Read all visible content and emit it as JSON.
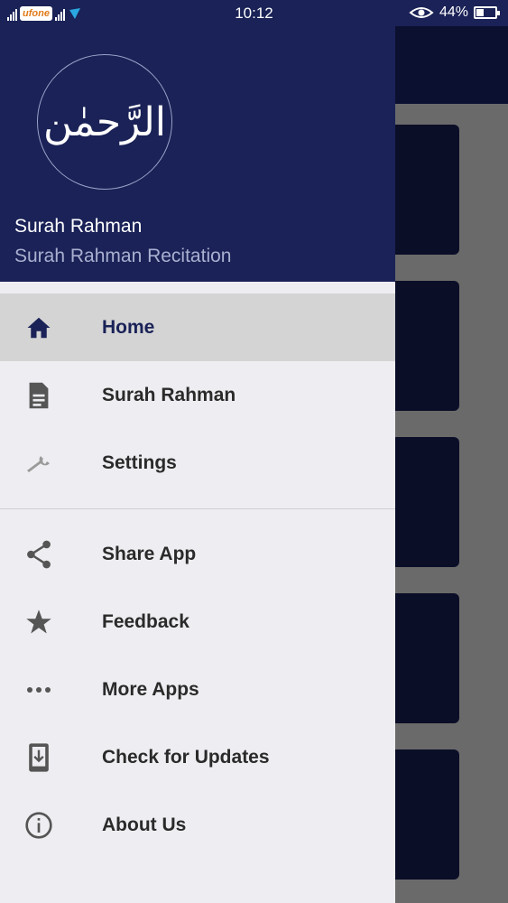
{
  "status_bar": {
    "carrier": "ufone",
    "time": "10:12",
    "battery": "44%"
  },
  "drawer": {
    "header": {
      "logo_text": "الرَّحمٰن",
      "title": "Surah Rahman",
      "subtitle": "Surah Rahman Recitation"
    },
    "primary_items": [
      {
        "label": "Home",
        "icon": "home-icon",
        "active": true
      },
      {
        "label": "Surah Rahman",
        "icon": "document-icon"
      },
      {
        "label": "Settings",
        "icon": "wrench-icon"
      }
    ],
    "secondary_items": [
      {
        "label": "Share App",
        "icon": "share-icon"
      },
      {
        "label": "Feedback",
        "icon": "star-icon"
      },
      {
        "label": "More Apps",
        "icon": "more-dots-icon"
      },
      {
        "label": "Check for Updates",
        "icon": "download-icon"
      },
      {
        "label": "About Us",
        "icon": "info-icon"
      }
    ]
  },
  "colors": {
    "header_bg": "#1a2257",
    "drawer_bg": "#eeedf1",
    "active_bg": "#d4d4d4",
    "icon_gray": "#555555"
  }
}
